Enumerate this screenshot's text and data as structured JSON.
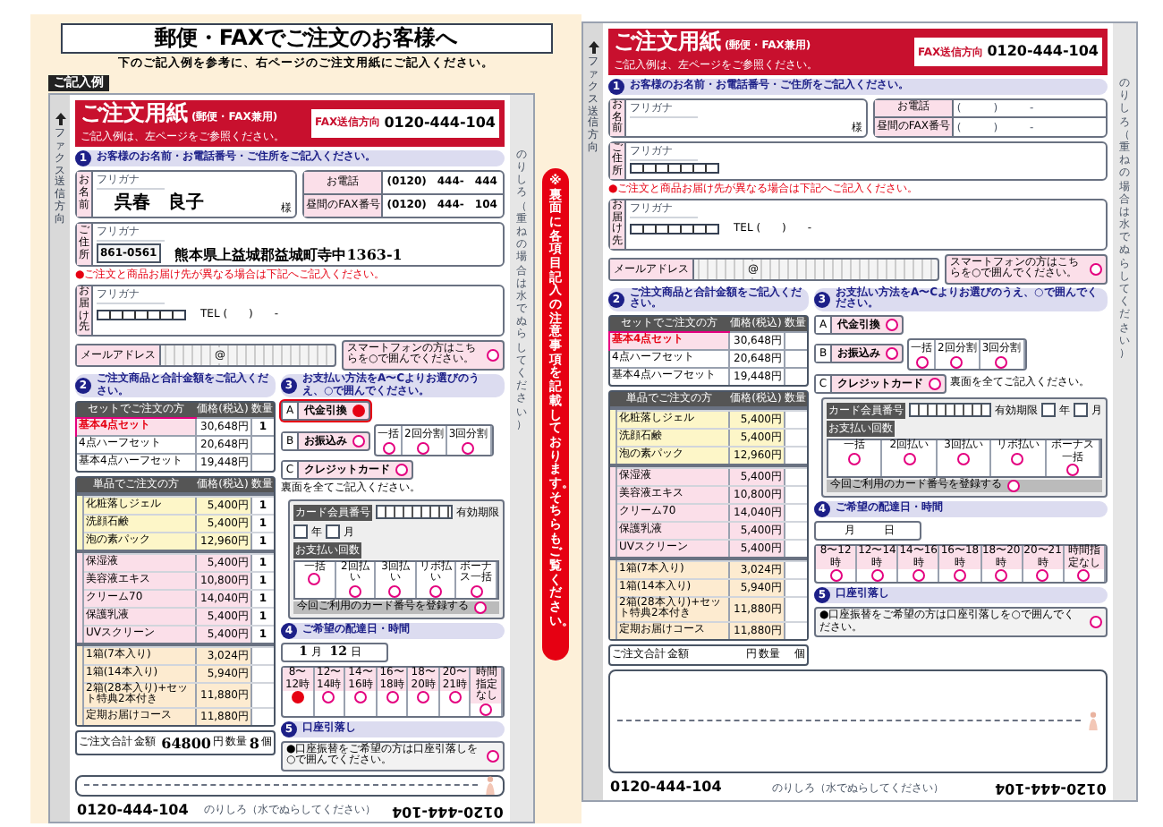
{
  "header": {
    "title": "郵便・FAXでご注文のお客様へ",
    "subtitle": "下のご記入例を参考に、右ページのご注文用紙にご記入ください。"
  },
  "example_label": "ご記入例",
  "side_notice": "※裏面に各項目記入の注意事項を記載しております。そちらもご覧ください。",
  "forms": [
    {
      "title": "ご注文用紙",
      "title_note": "(郵便・FAX兼用)",
      "subtitle": "ご記入例は、左ページをご参照ください。",
      "fax_label": "FAX送信方向",
      "fax_number": "0120-444-104",
      "left_strip": "ファクス送信方向",
      "right_strip": "のりしろ（重ねの場合は水でぬらしてください）",
      "section1": {
        "number": "1",
        "heading": "お客様のお名前・お電話番号・ご住所をご記入ください。",
        "name_label": "お名前",
        "name_furigana": "フリガナ",
        "name": "呉春　良子",
        "honorific": "様",
        "phone_label": "お電話",
        "phone": "(0120)　444-　444",
        "phone2_label": "昼間のFAX番号",
        "phone2": "(0120)　444-　104",
        "address_label": "ご住所",
        "address_furigana": "フリガナ",
        "postal": "861-0561",
        "address": "熊本県上益城郡益城町寺中1363-1",
        "delivery_note": "●ご注文と商品お届け先が異なる場合は下記へご記入ください。",
        "delivery_label": "お届け先",
        "delivery_furigana": "フリガナ",
        "tel": "TEL (　　)　　-"
      },
      "email": {
        "label": "メールアドレス",
        "at": "@",
        "smartphone": "スマートフォンの方はこちらを○で囲んでください。",
        "selected": false
      },
      "section2": {
        "number": "2",
        "heading": "ご注文商品と合計金額をご記入ください。",
        "columns": [
          "セットでご注文の方",
          "価格(税込)",
          "数量"
        ],
        "set_rows": [
          {
            "name": "基本4点セット",
            "price": "30,648円",
            "qty": "1",
            "featured": true
          },
          {
            "name": "4点ハーフセット",
            "price": "20,648円",
            "qty": "",
            "featured": false
          },
          {
            "name": "基本4点ハーフセット",
            "price": "19,448円",
            "qty": "",
            "featured": false
          }
        ],
        "single_columns": [
          "単品でご注文の方",
          "価格(税込)",
          "数量"
        ],
        "groups": [
          {
            "color": "#fdf6c8",
            "rows": [
              {
                "name": "化粧落しジェル",
                "price": "5,400円",
                "qty": "1"
              },
              {
                "name": "洗顔石鹸",
                "price": "5,400円",
                "qty": "1"
              },
              {
                "name": "泡の素パック",
                "price": "12,960円",
                "qty": "1"
              }
            ]
          },
          {
            "color": "#fbdfe9",
            "rows": [
              {
                "name": "保湿液",
                "price": "5,400円",
                "qty": "1"
              },
              {
                "name": "美容液エキス",
                "price": "10,800円",
                "qty": "1"
              },
              {
                "name": "クリーム70",
                "price": "14,040円",
                "qty": "1"
              },
              {
                "name": "保護乳液",
                "price": "5,400円",
                "qty": "1"
              },
              {
                "name": "UVスクリーン",
                "price": "5,400円",
                "qty": "1"
              }
            ]
          },
          {
            "color": "#fdebd0",
            "rows": [
              {
                "name": "1箱(7本入り)",
                "price": "3,024円",
                "qty": ""
              },
              {
                "name": "1箱(14本入り)",
                "price": "5,940円",
                "qty": ""
              },
              {
                "name": "2箱(28本入り)+セット特典2本付き",
                "price": "11,880円",
                "qty": ""
              },
              {
                "name": "定期お届けコース",
                "price": "11,880円",
                "qty": ""
              }
            ]
          }
        ],
        "total": {
          "label": "ご注文合計",
          "amount_label": "金額",
          "amount": "64800",
          "yen": "円",
          "qty_label": "数量",
          "qty": "8",
          "unit": "個"
        }
      },
      "section3": {
        "number": "3",
        "heading": "お支払い方法をA〜Cよりお選びのうえ、○で囲んでください。",
        "options": [
          {
            "letter": "A",
            "label": "代金引換",
            "selected": true
          },
          {
            "letter": "B",
            "label": "お振込み",
            "selected": false
          },
          {
            "letter": "C",
            "label": "クレジットカード",
            "selected": false
          }
        ],
        "transfer_splits": [
          "一括",
          "2回分割",
          "3回分割"
        ],
        "card_note": "裏面を全てご記入ください。",
        "card_number_label": "カード会員番号",
        "expiry_label": "有効期限",
        "year": "年",
        "month": "月",
        "times_label": "お支払い回数",
        "times": [
          "一括",
          "2回払い",
          "3回払い",
          "リボ払い",
          "ボーナス一括"
        ],
        "register": "今回ご利用のカード番号を登録する"
      },
      "section4": {
        "number": "4",
        "heading": "ご希望の配達日・時間",
        "month": "1",
        "month_unit": "月",
        "day": "12",
        "day_unit": "日",
        "slots": [
          {
            "label": "8〜12時",
            "selected": true
          },
          {
            "label": "12〜14時",
            "selected": false
          },
          {
            "label": "14〜16時",
            "selected": false
          },
          {
            "label": "16〜18時",
            "selected": false
          },
          {
            "label": "18〜20時",
            "selected": false
          },
          {
            "label": "20〜21時",
            "selected": false
          },
          {
            "label": "時間指定なし",
            "selected": false
          }
        ]
      },
      "section5": {
        "number": "5",
        "heading": "口座引落し",
        "note": "●口座振替をご希望の方は口座引落しを○で囲んでください。"
      },
      "footer": {
        "phone": "0120-444-104",
        "glue": "のりしろ（水でぬらしてください）",
        "phone_upside_down": "0120-444-104"
      }
    },
    {
      "title": "ご注文用紙",
      "title_note": "(郵便・FAX兼用)",
      "subtitle": "ご記入例は、左ページをご参照ください。",
      "fax_label": "FAX送信方向",
      "fax_number": "0120-444-104",
      "left_strip": "ファクス送信方向",
      "right_strip": "のりしろ（重ねの場合は水でぬらしてください）",
      "section1": {
        "number": "1",
        "heading": "お客様のお名前・お電話番号・ご住所をご記入ください。",
        "name_label": "お名前",
        "name_furigana": "フリガナ",
        "honorific": "様",
        "phone_label": "お電話",
        "phone": "(　　　)　　　-",
        "phone2_label": "昼間のFAX番号",
        "phone2": "(　　　)　　　-",
        "address_label": "ご住所",
        "address_furigana": "フリガナ",
        "delivery_note": "●ご注文と商品お届け先が異なる場合は下記へご記入ください。",
        "delivery_label": "お届け先",
        "delivery_furigana": "フリガナ",
        "tel": "TEL (　　)　　-"
      },
      "email": {
        "label": "メールアドレス",
        "at": "@",
        "smartphone": "スマートフォンの方はこちらを○で囲んでください。",
        "selected": false
      },
      "section2": {
        "number": "2",
        "heading": "ご注文商品と合計金額をご記入ください。",
        "columns": [
          "セットでご注文の方",
          "価格(税込)",
          "数量"
        ],
        "set_rows": [
          {
            "name": "基本4点セット",
            "price": "30,648円",
            "qty": "",
            "featured": true
          },
          {
            "name": "4点ハーフセット",
            "price": "20,648円",
            "qty": "",
            "featured": false
          },
          {
            "name": "基本4点ハーフセット",
            "price": "19,448円",
            "qty": "",
            "featured": false
          }
        ],
        "single_columns": [
          "単品でご注文の方",
          "価格(税込)",
          "数量"
        ],
        "groups": [
          {
            "color": "#fdf6c8",
            "rows": [
              {
                "name": "化粧落しジェル",
                "price": "5,400円",
                "qty": ""
              },
              {
                "name": "洗顔石鹸",
                "price": "5,400円",
                "qty": ""
              },
              {
                "name": "泡の素パック",
                "price": "12,960円",
                "qty": ""
              }
            ]
          },
          {
            "color": "#fbdfe9",
            "rows": [
              {
                "name": "保湿液",
                "price": "5,400円",
                "qty": ""
              },
              {
                "name": "美容液エキス",
                "price": "10,800円",
                "qty": ""
              },
              {
                "name": "クリーム70",
                "price": "14,040円",
                "qty": ""
              },
              {
                "name": "保護乳液",
                "price": "5,400円",
                "qty": ""
              },
              {
                "name": "UVスクリーン",
                "price": "5,400円",
                "qty": ""
              }
            ]
          },
          {
            "color": "#fdebd0",
            "rows": [
              {
                "name": "1箱(7本入り)",
                "price": "3,024円",
                "qty": ""
              },
              {
                "name": "1箱(14本入り)",
                "price": "5,940円",
                "qty": ""
              },
              {
                "name": "2箱(28本入り)+セット特典2本付き",
                "price": "11,880円",
                "qty": ""
              },
              {
                "name": "定期お届けコース",
                "price": "11,880円",
                "qty": ""
              }
            ]
          }
        ],
        "total": {
          "label": "ご注文合計",
          "amount_label": "金額",
          "yen": "円",
          "qty_label": "数量",
          "unit": "個"
        }
      },
      "section3": {
        "number": "3",
        "heading": "お支払い方法をA〜Cよりお選びのうえ、○で囲んでください。",
        "options": [
          {
            "letter": "A",
            "label": "代金引換",
            "selected": false
          },
          {
            "letter": "B",
            "label": "お振込み",
            "selected": false
          },
          {
            "letter": "C",
            "label": "クレジットカード",
            "selected": false
          }
        ],
        "transfer_splits": [
          "一括",
          "2回分割",
          "3回分割"
        ],
        "card_note": "裏面を全てご記入ください。",
        "card_number_label": "カード会員番号",
        "expiry_label": "有効期限",
        "year": "年",
        "month": "月",
        "times_label": "お支払い回数",
        "times": [
          "一括",
          "2回払い",
          "3回払い",
          "リボ払い",
          "ボーナス一括"
        ],
        "register": "今回ご利用のカード番号を登録する"
      },
      "section4": {
        "number": "4",
        "heading": "ご希望の配達日・時間",
        "month_unit": "月",
        "day_unit": "日",
        "slots": [
          {
            "label": "8〜12時",
            "selected": false
          },
          {
            "label": "12〜14時",
            "selected": false
          },
          {
            "label": "14〜16時",
            "selected": false
          },
          {
            "label": "16〜18時",
            "selected": false
          },
          {
            "label": "18〜20時",
            "selected": false
          },
          {
            "label": "20〜21時",
            "selected": false
          },
          {
            "label": "時間指定なし",
            "selected": false
          }
        ]
      },
      "section5": {
        "number": "5",
        "heading": "口座引落し",
        "note": "●口座振替をご希望の方は口座引落しを○で囲んでください。"
      },
      "footer": {
        "phone": "0120-444-104",
        "glue": "のりしろ（水でぬらしてください）",
        "phone_upside_down": "0120-444-104"
      }
    }
  ]
}
